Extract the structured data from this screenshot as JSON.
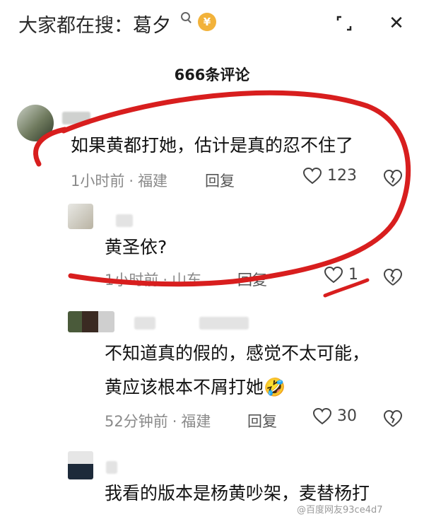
{
  "header": {
    "search_prefix": "大家都在搜：",
    "search_keyword": "葛夕",
    "hot_badge": "🔥",
    "close_label": "✕"
  },
  "comments_count": "666条评论",
  "comments": [
    {
      "text": "如果黄都打她，估计是真的忍不住了",
      "time": "1小时前",
      "location": "福建",
      "reply_label": "回复",
      "likes": "123"
    },
    {
      "text": "黄圣依?",
      "time": "1小时前",
      "location": "山东",
      "reply_label": "回复",
      "likes": "1"
    },
    {
      "text_line1": "不知道真的假的，感觉不太可能，",
      "text_line2": "黄应该根本不屑打她🤣",
      "time": "52分钟前",
      "location": "福建",
      "reply_label": "回复",
      "likes": "30"
    },
    {
      "text": "我看的版本是杨黄吵架，麦替杨打"
    }
  ],
  "watermark": "@百度网友93ce4d7",
  "colors": {
    "annotation_red": "#d81e1e",
    "meta_gray": "#8a8a8a"
  }
}
